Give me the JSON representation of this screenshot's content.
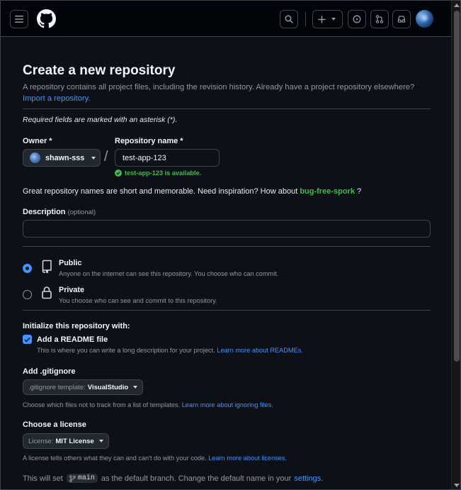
{
  "header": {
    "menu_icon": "hamburger-icon",
    "logo_icon": "github-logo-icon",
    "search_icon": "search-icon",
    "create_icon": "plus-icon",
    "issues_icon": "issue-opened-icon",
    "pulls_icon": "git-pull-request-icon",
    "inbox_icon": "inbox-icon"
  },
  "page": {
    "title": "Create a new repository",
    "description": "A repository contains all project files, including the revision history. Already have a project repository elsewhere?",
    "import_link": "Import a repository.",
    "required_note": "Required fields are marked with an asterisk (*)."
  },
  "owner": {
    "label": "Owner *",
    "value": "shawn-sss"
  },
  "repo": {
    "label": "Repository name *",
    "value": "test-app-123",
    "available": "test-app-123 is available."
  },
  "inspiration": {
    "text": "Great repository names are short and memorable. Need inspiration? How about",
    "suggestion": "bug-free-spork",
    "suffix": "?"
  },
  "description": {
    "label": "Description",
    "optional": "(optional)",
    "value": ""
  },
  "visibility": {
    "public_title": "Public",
    "public_desc": "Anyone on the internet can see this repository. You choose who can commit.",
    "private_title": "Private",
    "private_desc": "You choose who can see and commit to this repository.",
    "selected": "public"
  },
  "init": {
    "title": "Initialize this repository with:",
    "readme_label": "Add a README file",
    "readme_checked": true,
    "readme_desc": "This is where you can write a long description for your project.",
    "readme_link": "Learn more about READMEs."
  },
  "gitignore": {
    "title": "Add .gitignore",
    "select_prefix": ".gitignore template:",
    "select_value": "VisualStudio",
    "desc": "Choose which files not to track from a list of templates.",
    "link": "Learn more about ignoring files."
  },
  "license": {
    "title": "Choose a license",
    "select_prefix": "License:",
    "select_value": "MIT License",
    "desc": "A license tells others what they can and can't do with your code.",
    "link": "Learn more about licenses."
  },
  "branch": {
    "prefix": "This will set",
    "name": "main",
    "middle": "as the default branch. Change the default name in your",
    "link": "settings",
    "suffix": "."
  },
  "colors": {
    "accent": "#4493f8",
    "success": "#3fb950",
    "background": "#0d1117",
    "border": "#3d444d"
  }
}
